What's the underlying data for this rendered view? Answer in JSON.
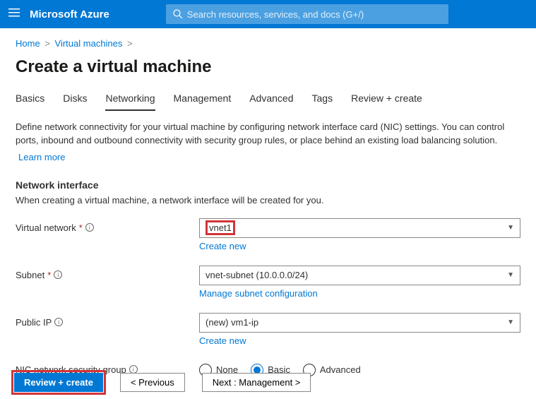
{
  "topbar": {
    "brand": "Microsoft Azure",
    "search_placeholder": "Search resources, services, and docs (G+/)"
  },
  "breadcrumb": {
    "home": "Home",
    "vms": "Virtual machines"
  },
  "page_title": "Create a virtual machine",
  "tabs": {
    "basics": "Basics",
    "disks": "Disks",
    "networking": "Networking",
    "management": "Management",
    "advanced": "Advanced",
    "tags": "Tags",
    "review": "Review + create"
  },
  "desc": "Define network connectivity for your virtual machine by configuring network interface card (NIC) settings. You can control ports, inbound and outbound connectivity with security group rules, or place behind an existing load balancing solution.",
  "learn_more": "Learn more",
  "section": {
    "title": "Network interface",
    "sub": "When creating a virtual machine, a network interface will be created for you."
  },
  "fields": {
    "vnet": {
      "label": "Virtual network",
      "value": "vnet1",
      "create_new": "Create new"
    },
    "subnet": {
      "label": "Subnet",
      "value": "vnet-subnet (10.0.0.0/24)",
      "manage": "Manage subnet configuration"
    },
    "publicip": {
      "label": "Public IP",
      "value": "(new) vm1-ip",
      "create_new": "Create new"
    },
    "nsg": {
      "label": "NIC network security group",
      "none": "None",
      "basic": "Basic",
      "advanced": "Advanced"
    }
  },
  "footer": {
    "review": "Review + create",
    "previous": "< Previous",
    "next": "Next : Management >"
  }
}
